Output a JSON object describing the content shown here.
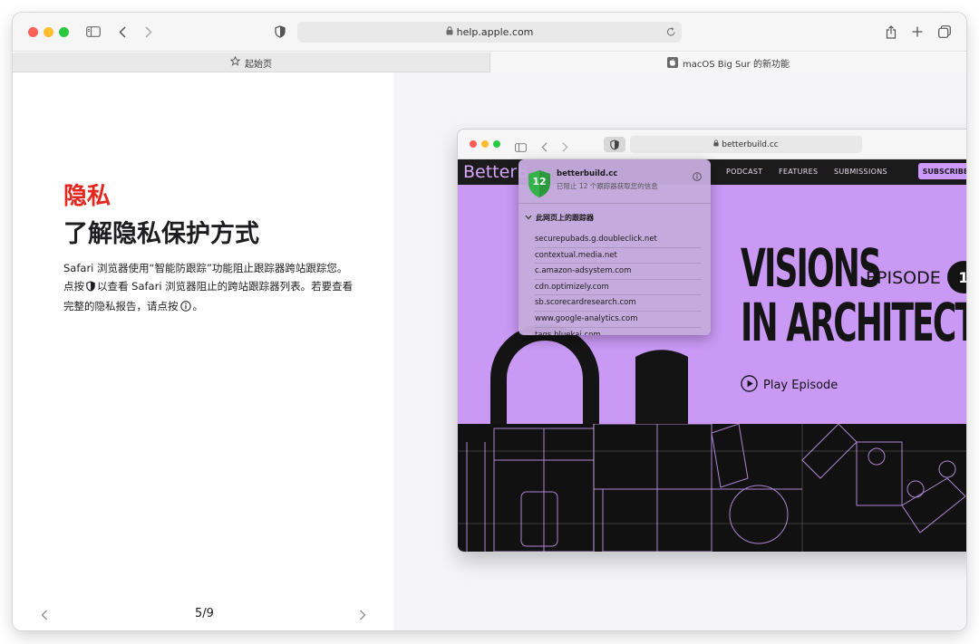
{
  "browser": {
    "url": "help.apple.com",
    "tabs": [
      {
        "label": "起始页",
        "icon": "star-icon"
      },
      {
        "label": "macOS Big Sur 的新功能",
        "icon": "apple-icon"
      }
    ]
  },
  "article": {
    "kicker": "隐私",
    "title": "了解隐私保护方式",
    "body_part1": "Safari 浏览器使用“智能防跟踪”功能阻止跟踪器跨站跟踪您。点按",
    "body_part2": "以查看 Safari 浏览器阻止的跨站跟踪器列表。若要查看完整的隐私报告，请点按",
    "body_part3": "。",
    "page_indicator": "5/9"
  },
  "inner_browser": {
    "url": "betterbuild.cc"
  },
  "site": {
    "logo": "BetterB",
    "nav": [
      "PODCAST",
      "FEATURES",
      "SUBMISSIONS"
    ],
    "subscribe": "SUBSCRIBE",
    "hero_line1": "VISIONS",
    "hero_line2": "IN ARCHITECTURE",
    "episode": "EPISODE",
    "episode_number": "1",
    "play": "Play Episode"
  },
  "privacy_popover": {
    "tracker_count": "12",
    "site": "betterbuild.cc",
    "subtitle": "已阻止 12 个跟踪器获取您的信息",
    "section": "此网页上的跟踪器",
    "trackers": [
      "securepubads.g.doubleclick.net",
      "contextual.media.net",
      "c.amazon-adsystem.com",
      "cdn.optimizely.com",
      "sb.scorecardresearch.com",
      "www.google-analytics.com",
      "tags.bluekai.com"
    ]
  },
  "colors": {
    "accent_red": "#e3261e",
    "hero_purple": "#c999f5",
    "shield_green": "#36b24a"
  }
}
